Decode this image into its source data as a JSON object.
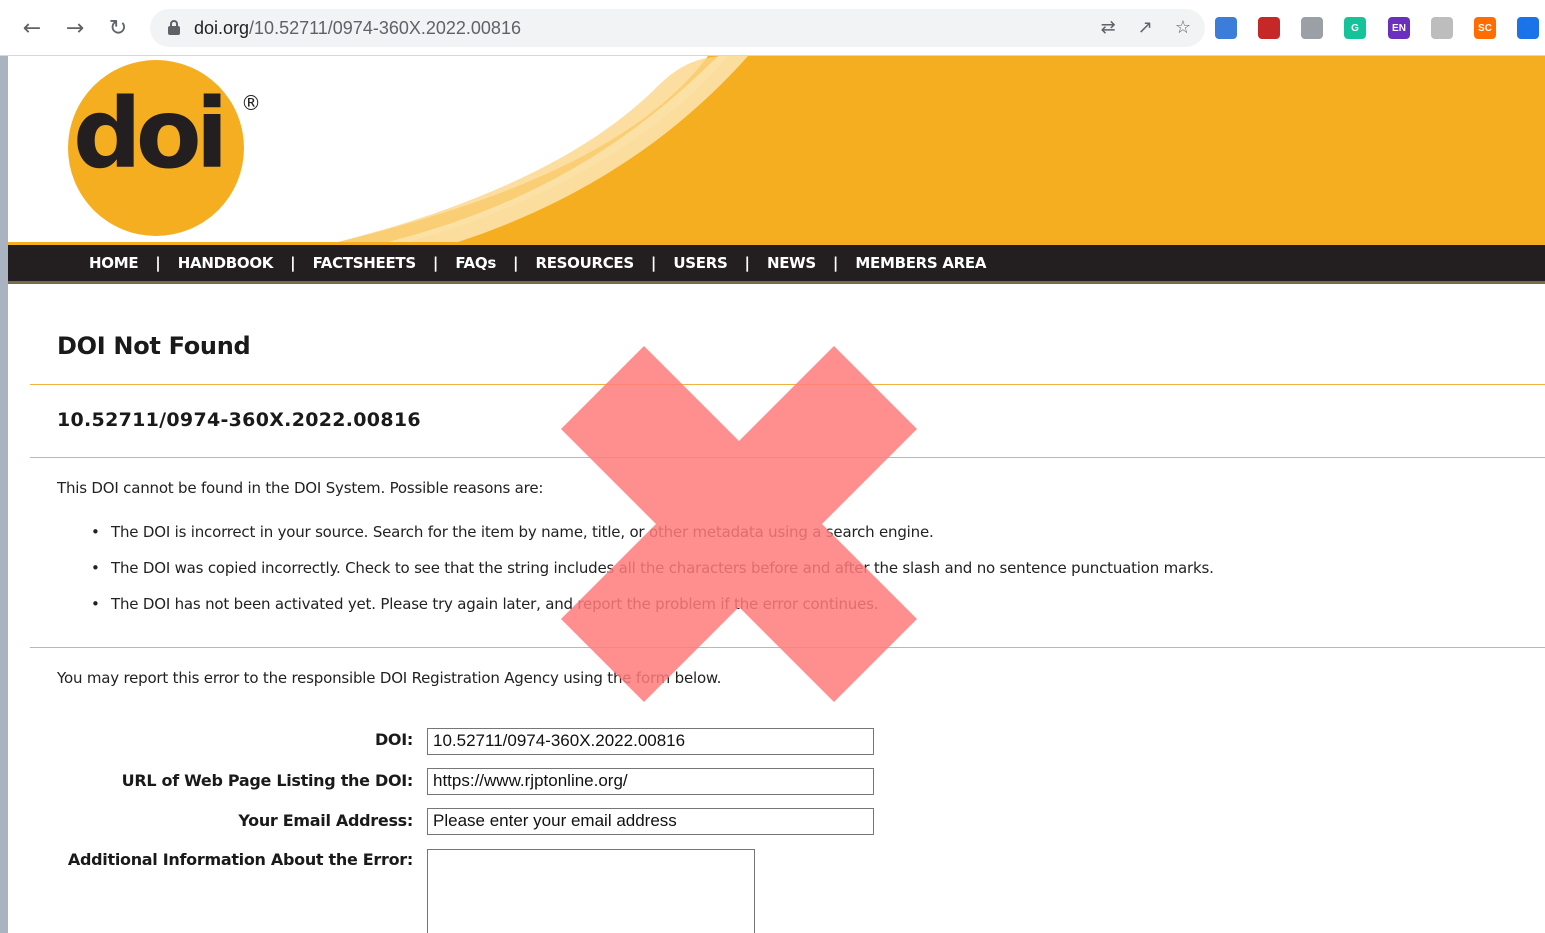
{
  "browser": {
    "url_host": "doi.org",
    "url_path": "/10.52711/0974-360X.2022.00816",
    "back_icon": "arrow-left-icon",
    "forward_icon": "arrow-right-icon",
    "reload_icon": "reload-icon",
    "extensions": [
      {
        "name": "extension-person-icon",
        "color": "#3b7dd8",
        "label": ""
      },
      {
        "name": "extension-red-icon",
        "color": "#c62828",
        "label": ""
      },
      {
        "name": "extension-shield-icon",
        "color": "#9aa0a6",
        "label": ""
      },
      {
        "name": "extension-grammarly-icon",
        "color": "#15c39a",
        "label": "G"
      },
      {
        "name": "extension-en-icon",
        "color": "#6b2fbf",
        "label": "EN"
      },
      {
        "name": "extension-page-icon",
        "color": "#bdbdbd",
        "label": ""
      },
      {
        "name": "extension-sc-icon",
        "color": "#ff6d00",
        "label": "SC"
      },
      {
        "name": "extension-blue-icon",
        "color": "#1a73e8",
        "label": ""
      }
    ]
  },
  "site": {
    "logo_text": "doi",
    "logo_reg": "®",
    "brand_color": "#f6ae21",
    "nav": [
      "HOME",
      "HANDBOOK",
      "FACTSHEETS",
      "FAQs",
      "RESOURCES",
      "USERS",
      "NEWS",
      "MEMBERS AREA"
    ]
  },
  "content": {
    "title": "DOI Not Found",
    "doi": "10.52711/0974-360X.2022.00816",
    "intro": "This DOI cannot be found in the DOI System. Possible reasons are:",
    "reasons": [
      "The DOI is incorrect in your source. Search for the item by name, title, or other metadata using a search engine.",
      "The DOI was copied incorrectly. Check to see that the string includes all the characters before and after the slash and no sentence punctuation marks.",
      "The DOI has not been activated yet. Please try again later, and report the problem if the error continues."
    ],
    "report": "You may report this error to the responsible DOI Registration Agency using the form below."
  },
  "form": {
    "doi_label": "DOI:",
    "doi_value": "10.52711/0974-360X.2022.00816",
    "url_label": "URL of Web Page Listing the DOI:",
    "url_value": "https://www.rjptonline.org/",
    "email_label": "Your Email Address:",
    "email_value": "Please enter your email address",
    "info_label": "Additional Information About the Error:"
  },
  "overlay": {
    "name": "red-x-icon",
    "color": "#ff7a7a"
  }
}
